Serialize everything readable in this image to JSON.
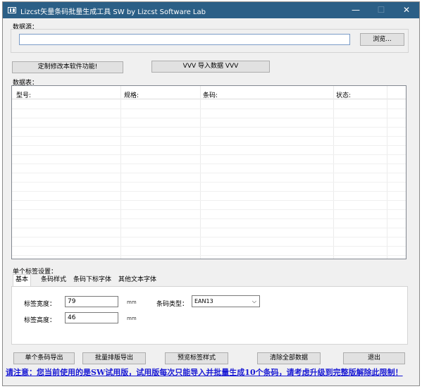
{
  "window": {
    "title": "Lizcst矢量条码批量生成工具 SW  by Lizcst Software Lab",
    "minimize": "—",
    "maximize": "☐",
    "close": "✕"
  },
  "source": {
    "label": "数据源：",
    "path_value": "",
    "browse_button": "浏览..."
  },
  "toolbar": {
    "customize_button": "定制修改本软件功能!",
    "import_button": "VVV 导入数据 VVV"
  },
  "table": {
    "label": "数据表：",
    "columns": [
      "型号:",
      "规格:",
      "条码:",
      "状态:"
    ]
  },
  "label_settings": {
    "label": "单个标签设置：",
    "tabs": [
      "基本",
      "条码样式",
      "条码下标字体",
      "其他文本字体"
    ],
    "width_label": "标签宽度：",
    "width_value": "79",
    "width_unit": "mm",
    "height_label": "标签高度：",
    "height_value": "46",
    "height_unit": "mm",
    "barcode_type_label": "条码类型：",
    "barcode_type_value": "EAN13"
  },
  "actions": {
    "single_export": "单个条码导出",
    "batch_export": "批量排版导出",
    "preview": "预览标签样式",
    "clear_all": "清除全部数据",
    "exit": "退出"
  },
  "notice": "请注意：您当前使用的是SW试用版，试用版每次只能导入并批量生成10个条码，请考虑升级到完整版解除此限制！"
}
